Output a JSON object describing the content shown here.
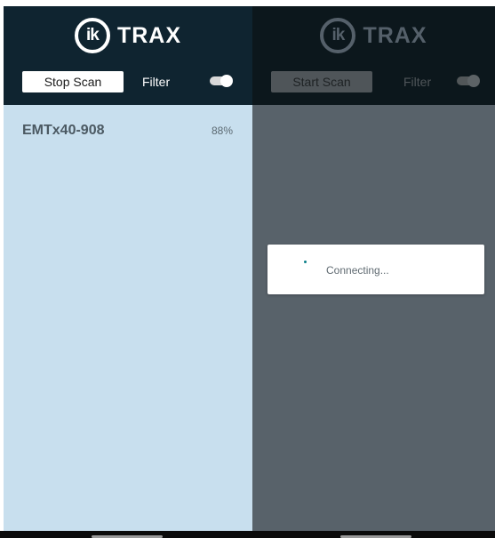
{
  "left_screen": {
    "brand": {
      "mark": "ik",
      "name": "TRAX"
    },
    "scan_button_label": "Stop Scan",
    "filter_label": "Filter",
    "filter_enabled": true,
    "devices": [
      {
        "name": "EMTx40-908",
        "signal": "88%"
      }
    ]
  },
  "right_screen": {
    "brand": {
      "mark": "ik",
      "name": "TRAX"
    },
    "scan_button_label": "Start Scan",
    "filter_label": "Filter",
    "filter_enabled": true,
    "dialog": {
      "message": "Connecting...",
      "icon": "spinner-icon"
    }
  },
  "colors": {
    "header": "#0f2430",
    "list_background": "#c8dfee",
    "dim_overlay": "#58626a",
    "spinner": "#0a7f88"
  }
}
